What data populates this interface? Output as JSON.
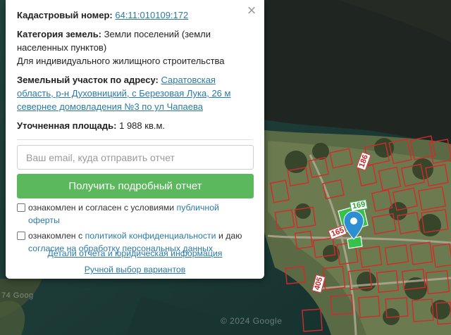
{
  "popup": {
    "close_icon": "×",
    "cadastral": {
      "label": "Кадастровый номер:",
      "value": "64:11:010109:172"
    },
    "category": {
      "label": "Категория земель:",
      "value": "Земли поселений (земли населенных пунктов)",
      "usage": "Для индивидуального жилищного строительства"
    },
    "address": {
      "label": "Земельный участок по адресу:",
      "value": "Саратовская область, р-н Духовницкий, с Березовая Лука, 26 м севернее домовладения №3 по ул Чапаева"
    },
    "area": {
      "label": "Уточненная площадь:",
      "value": "1 988 кв.м."
    },
    "email_placeholder": "Ваш email, куда отправить отчет",
    "report_button": "Получить подробный отчет",
    "consent1": {
      "text": "ознакомлен и согласен с условиями",
      "link": "публичной оферты"
    },
    "consent2": {
      "text": "ознакомлен с",
      "link1": "политикой конфиденциальности",
      "middle": "и даю",
      "link2": "согласие на обработку персональных данных"
    },
    "details_link": "Детали отчета и юридическая информация",
    "manual_link": "Ручной выбор вариантов"
  },
  "map": {
    "parcel_labels": [
      "186",
      "169",
      "165",
      "405"
    ],
    "watermark_left": "74 Goog",
    "watermark_bottom": "© 2024 Google"
  },
  "colors": {
    "accent_green": "#5cb85c",
    "link_blue": "#2a7aa8",
    "parcel_red": "#d42a2a",
    "marker_blue": "#2d8fd3"
  }
}
